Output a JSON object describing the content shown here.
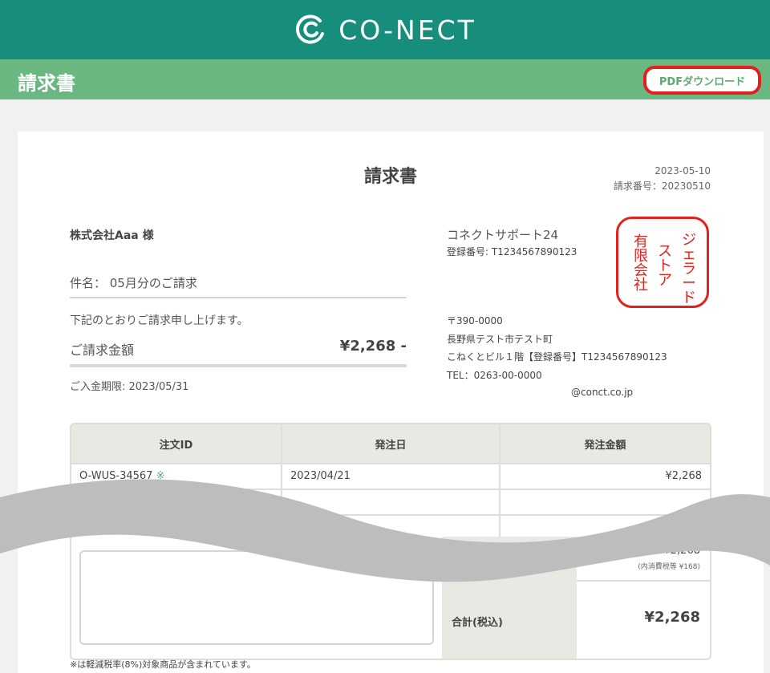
{
  "header": {
    "logo_text": "CO-NECT",
    "logo_icon": "conect-logo-icon",
    "bg_color": "#178d7c"
  },
  "subbar": {
    "title": "請求書",
    "pdf_button": "PDFダウンロード",
    "bg_color": "#6bb782",
    "highlight_color": "#e0211c"
  },
  "invoice": {
    "title": "請求書",
    "date": "2023-05-10",
    "number": "請求番号：20230510",
    "client": "株式会社Aaa 様",
    "subject": "件名： 05月分のご請求",
    "notice": "下記のとおりご請求申し上げます。",
    "amount_label": "ご請求金額",
    "amount_value": "¥2,268 -",
    "deadline": "ご入金期限: 2023/05/31"
  },
  "issuer": {
    "name": "コネクトサポート24",
    "registration": "登録番号: T1234567890123",
    "postal": "〒390-0000",
    "address1": "長野県テスト市テスト町",
    "address2": "こねくとビル１階【登録番号】T1234567890123",
    "tel": "TEL：0263-00-0000",
    "email": "@conct.co.jp",
    "stamp": {
      "col1": "ジェラード",
      "col2": "ストア",
      "col3": "有限会社"
    }
  },
  "table": {
    "headers": [
      "注文ID",
      "発注日",
      "発注金額"
    ],
    "rows": [
      {
        "order_id": "O-WUS-34567",
        "mark": "※",
        "date": "2023/04/21",
        "amount": "¥2,268"
      }
    ],
    "subtotal_label_partial": "）",
    "subtotal_value": "¥2,268",
    "subtotal_tax": "(内消費税等 ¥168)",
    "total_label": "合計(税込)",
    "total_value": "¥2,268"
  },
  "footnote": "※は軽減税率(8%)対象商品が含まれています。"
}
